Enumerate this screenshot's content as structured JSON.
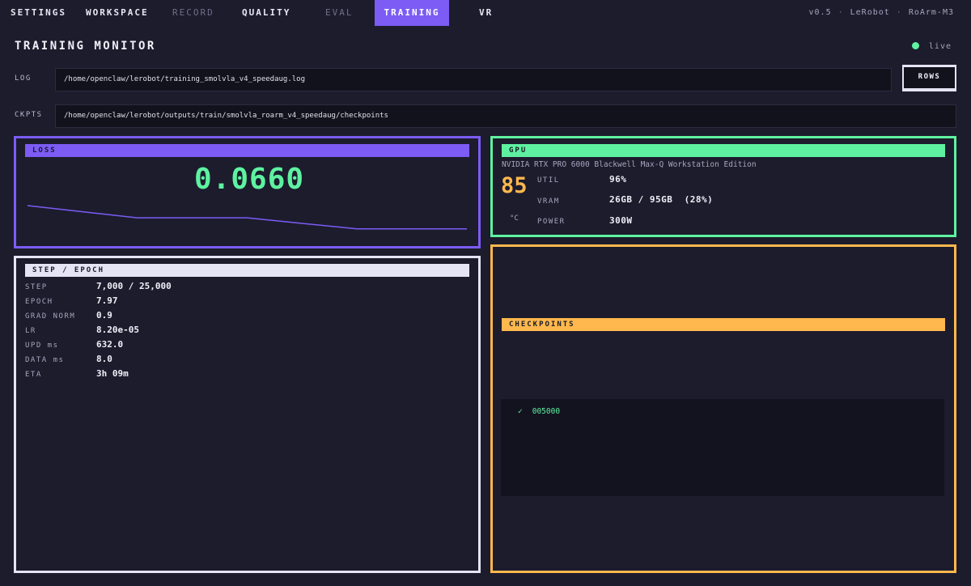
{
  "nav": {
    "tabs": [
      {
        "label": "SETTINGS",
        "state": "normal"
      },
      {
        "label": "WORKSPACE",
        "state": "normal"
      },
      {
        "label": "RECORD",
        "state": "dim"
      },
      {
        "label": "QUALITY",
        "state": "normal"
      },
      {
        "label": "EVAL",
        "state": "dim"
      },
      {
        "label": "TRAINING",
        "state": "active"
      },
      {
        "label": "VR",
        "state": "normal"
      }
    ],
    "meta": {
      "version": "v0.5",
      "app": "LeRobot",
      "robot": "RoArm-M3"
    }
  },
  "header": {
    "title": "TRAINING MONITOR",
    "status": "live"
  },
  "fields": {
    "log": {
      "label": "LOG",
      "value": "/home/openclaw/lerobot/training_smolvla_v4_speedaug.log"
    },
    "ckpts": {
      "label": "CKPTS",
      "value": "/home/openclaw/lerobot/outputs/train/smolvla_roarm_v4_speedaug/checkpoints"
    },
    "rows_button": "ROWS"
  },
  "loss": {
    "title": "LOSS",
    "value": "0.0660",
    "chart_data": {
      "type": "line",
      "x": [
        0,
        1,
        2,
        3,
        4
      ],
      "values": [
        1.0,
        0.58,
        0.58,
        0.2,
        0.2
      ],
      "title": "",
      "xlabel": "",
      "ylabel": "",
      "grid": false,
      "color": "#7c5cf5"
    }
  },
  "gpu": {
    "title": "GPU",
    "name": "NVIDIA RTX PRO 6000 Blackwell Max-Q Workstation Edition",
    "temp": "85",
    "temp_unit": "°C",
    "stats": [
      {
        "label": "UTIL",
        "value": "96%"
      },
      {
        "label": "VRAM",
        "value": "26GB / 95GB  (28%)"
      },
      {
        "label": "POWER",
        "value": "300W"
      }
    ]
  },
  "step": {
    "title": "STEP / EPOCH",
    "rows": [
      {
        "label": "STEP",
        "value": "7,000 / 25,000"
      },
      {
        "label": "EPOCH",
        "value": "7.97"
      },
      {
        "label": "GRAD NORM",
        "value": "0.9"
      },
      {
        "label": "LR",
        "value": "8.20e-05"
      },
      {
        "label": "UPD ms",
        "value": "632.0"
      },
      {
        "label": "DATA ms",
        "value": "8.0"
      },
      {
        "label": "ETA",
        "value": "3h 09m"
      }
    ]
  },
  "checkpoints": {
    "title": "CHECKPOINTS",
    "items": [
      {
        "check": "✓",
        "name": "005000"
      }
    ]
  },
  "colors": {
    "accent_purple": "#7c5cf5",
    "accent_green": "#5ef2a0",
    "accent_orange": "#ffb84d",
    "panel_white": "#e4e4f4",
    "background": "#1c1c2d"
  }
}
